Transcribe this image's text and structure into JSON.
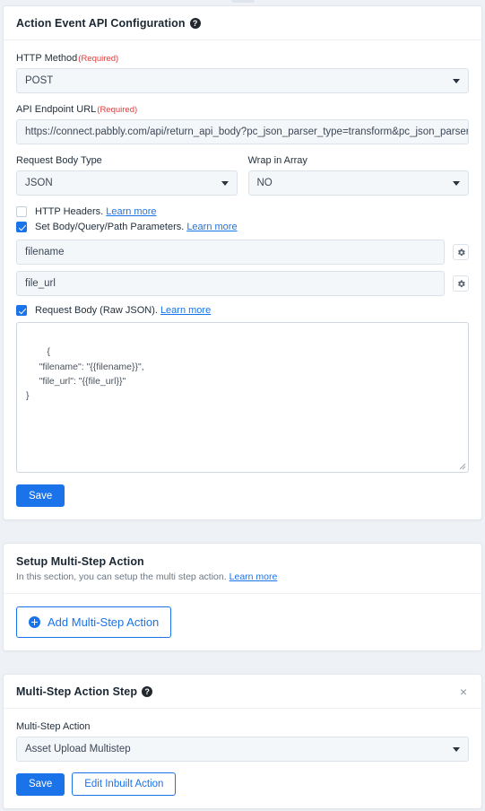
{
  "api_config": {
    "title": "Action Event API Configuration",
    "help_icon": "help-circle-icon",
    "http_method": {
      "label": "HTTP Method",
      "required_text": "(Required)",
      "value": "POST"
    },
    "api_endpoint": {
      "label": "API Endpoint URL",
      "required_text": "(Required)",
      "value": "https://connect.pabbly.com/api/return_api_body?pc_json_parser_type=transform&pc_json_parser_templ"
    },
    "request_body_type": {
      "label": "Request Body Type",
      "value": "JSON"
    },
    "wrap_in_array": {
      "label": "Wrap in Array",
      "value": "NO"
    },
    "http_headers": {
      "label": "HTTP Headers.",
      "link": "Learn more",
      "checked": false
    },
    "set_parameters": {
      "label": "Set Body/Query/Path Parameters.",
      "link": "Learn more",
      "checked": true
    },
    "parameters": [
      {
        "value": "filename",
        "gear_icon": "gear-icon"
      },
      {
        "value": "file_url",
        "gear_icon": "gear-icon"
      }
    ],
    "request_body_raw": {
      "label": "Request Body (Raw JSON).",
      "link": "Learn more",
      "checked": true,
      "content": "{\n     \"filename\": \"{{filename}}\",\n     \"file_url\": \"{{file_url}}\"\n}"
    },
    "save_label": "Save"
  },
  "setup_multistep": {
    "title": "Setup Multi-Step Action",
    "description": "In this section, you can setup the multi step action.",
    "link": "Learn more",
    "add_button_label": "Add Multi-Step Action",
    "add_button_icon": "plus-circle-icon"
  },
  "multistep_step": {
    "title": "Multi-Step Action Step",
    "help_icon": "help-circle-icon",
    "close_icon": "×",
    "action": {
      "label": "Multi-Step Action",
      "value": "Asset Upload Multistep"
    },
    "save_label": "Save",
    "edit_label": "Edit Inbuilt Action"
  },
  "colors": {
    "accent": "#1a73e8",
    "required": "#e23a3a",
    "page_bg": "#eef1f5"
  }
}
